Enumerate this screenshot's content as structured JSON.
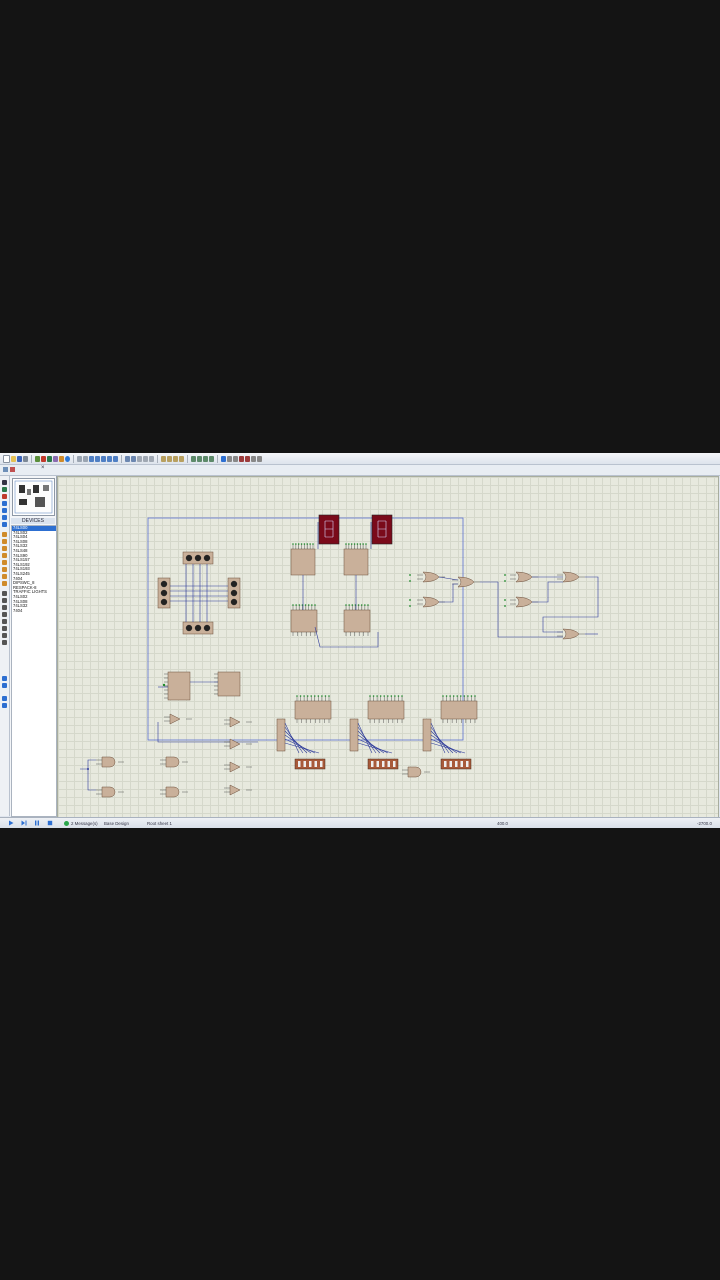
{
  "panel": {
    "devices_header": "DEVICES",
    "devices": [
      "74LS00",
      "74LS02",
      "74LS04",
      "74LS08",
      "74LS32",
      "74LS48",
      "74LS90",
      "74LS157",
      "74LS192",
      "74LS193",
      "74LS245",
      "7404",
      "DIPSWC_8",
      "RESPACK-8",
      "TRAFFIC LIGHTS",
      "74LS02",
      "74LS08",
      "74LS32",
      "7404"
    ],
    "selected_index": 0
  },
  "status": {
    "messages": "2 Message(s)",
    "design": "Base Design",
    "sheet": "Root sheet 1",
    "coord_x": "400.0",
    "coord_y": "-2700.0"
  },
  "colors": {
    "toolbar_bg": "#e6ebf2",
    "canvas_bg": "#e7e9de",
    "component": "#c9b09a",
    "wire": "#2d3a9a",
    "display": "#7a0a1a",
    "pin_green": "#1d8a2a"
  }
}
